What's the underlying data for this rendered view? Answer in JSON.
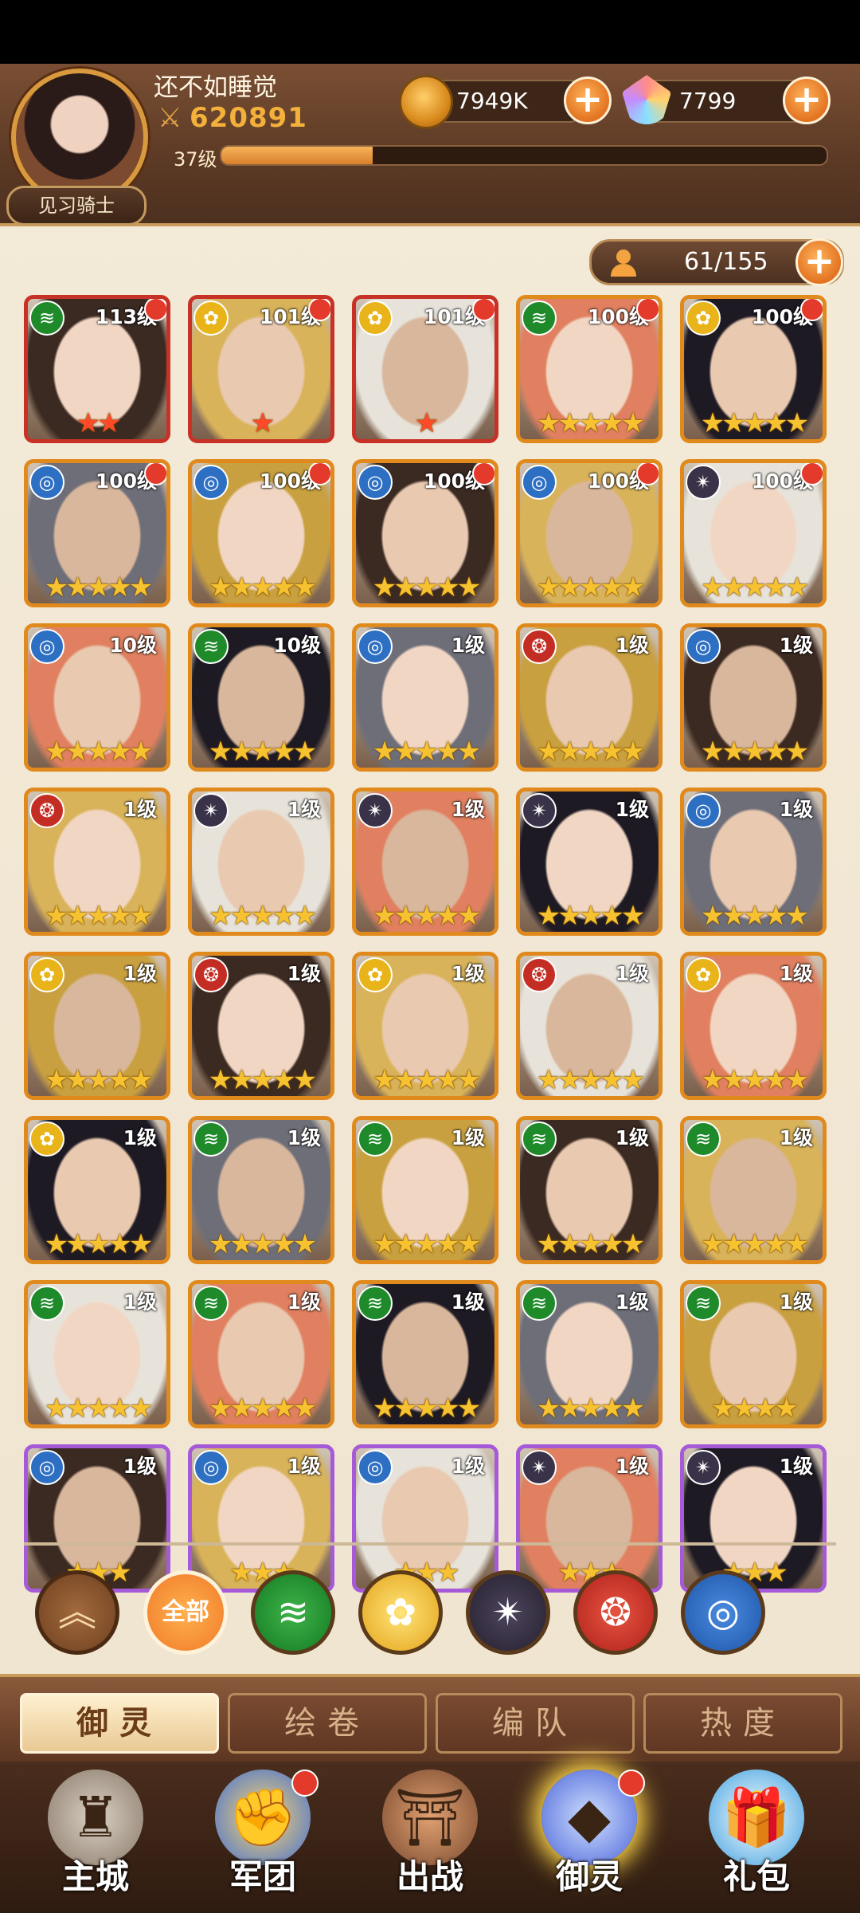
{
  "header": {
    "player_name": "还不如睡觉",
    "power": "620891",
    "level": "37级",
    "exp_progress": 0.25,
    "rank": "见习骑士",
    "gold": "7949K",
    "gems": "7799",
    "roster": "61/155"
  },
  "cards": [
    {
      "level": "113级",
      "element": "wind",
      "stars": 2,
      "frame": "red",
      "dot": true
    },
    {
      "level": "101级",
      "element": "light",
      "stars": 1,
      "frame": "red",
      "dot": true
    },
    {
      "level": "101级",
      "element": "light",
      "stars": 1,
      "frame": "red",
      "dot": true
    },
    {
      "level": "100级",
      "element": "wind",
      "stars": 5,
      "frame": "orange",
      "dot": true
    },
    {
      "level": "100级",
      "element": "light",
      "stars": 5,
      "frame": "orange",
      "dot": true
    },
    {
      "level": "100级",
      "element": "water",
      "stars": 5,
      "frame": "orange",
      "dot": true
    },
    {
      "level": "100级",
      "element": "water",
      "stars": 5,
      "frame": "orange",
      "dot": true
    },
    {
      "level": "100级",
      "element": "water",
      "stars": 5,
      "frame": "orange",
      "dot": true
    },
    {
      "level": "100级",
      "element": "water",
      "stars": 5,
      "frame": "orange",
      "dot": true
    },
    {
      "level": "100级",
      "element": "dark",
      "stars": 5,
      "frame": "orange",
      "dot": true
    },
    {
      "level": "10级",
      "element": "water",
      "stars": 5,
      "frame": "orange",
      "dot": false
    },
    {
      "level": "10级",
      "element": "wind",
      "stars": 5,
      "frame": "orange",
      "dot": false
    },
    {
      "level": "1级",
      "element": "water",
      "stars": 5,
      "frame": "orange",
      "dot": false
    },
    {
      "level": "1级",
      "element": "fire",
      "stars": 5,
      "frame": "orange",
      "dot": false
    },
    {
      "level": "1级",
      "element": "water",
      "stars": 5,
      "frame": "orange",
      "dot": false
    },
    {
      "level": "1级",
      "element": "fire",
      "stars": 5,
      "frame": "orange",
      "dot": false
    },
    {
      "level": "1级",
      "element": "dark",
      "stars": 5,
      "frame": "orange",
      "dot": false
    },
    {
      "level": "1级",
      "element": "dark",
      "stars": 5,
      "frame": "orange",
      "dot": false
    },
    {
      "level": "1级",
      "element": "dark",
      "stars": 5,
      "frame": "orange",
      "dot": false
    },
    {
      "level": "1级",
      "element": "water",
      "stars": 5,
      "frame": "orange",
      "dot": false
    },
    {
      "level": "1级",
      "element": "light",
      "stars": 5,
      "frame": "orange",
      "dot": false
    },
    {
      "level": "1级",
      "element": "fire",
      "stars": 5,
      "frame": "orange",
      "dot": false
    },
    {
      "level": "1级",
      "element": "light",
      "stars": 5,
      "frame": "orange",
      "dot": false
    },
    {
      "level": "1级",
      "element": "fire",
      "stars": 5,
      "frame": "orange",
      "dot": false
    },
    {
      "level": "1级",
      "element": "light",
      "stars": 5,
      "frame": "orange",
      "dot": false
    },
    {
      "level": "1级",
      "element": "light",
      "stars": 5,
      "frame": "orange",
      "dot": false
    },
    {
      "level": "1级",
      "element": "wind",
      "stars": 5,
      "frame": "orange",
      "dot": false
    },
    {
      "level": "1级",
      "element": "wind",
      "stars": 5,
      "frame": "orange",
      "dot": false
    },
    {
      "level": "1级",
      "element": "wind",
      "stars": 5,
      "frame": "orange",
      "dot": false
    },
    {
      "level": "1级",
      "element": "wind",
      "stars": 5,
      "frame": "orange",
      "dot": false
    },
    {
      "level": "1级",
      "element": "wind",
      "stars": 5,
      "frame": "orange",
      "dot": false
    },
    {
      "level": "1级",
      "element": "wind",
      "stars": 5,
      "frame": "orange",
      "dot": false
    },
    {
      "level": "1级",
      "element": "wind",
      "stars": 5,
      "frame": "orange",
      "dot": false
    },
    {
      "level": "1级",
      "element": "wind",
      "stars": 5,
      "frame": "orange",
      "dot": false
    },
    {
      "level": "1级",
      "element": "wind",
      "stars": 4,
      "frame": "orange",
      "dot": false
    },
    {
      "level": "1级",
      "element": "water",
      "stars": 3,
      "frame": "purple",
      "dot": false
    },
    {
      "level": "1级",
      "element": "water",
      "stars": 3,
      "frame": "purple",
      "dot": false
    },
    {
      "level": "1级",
      "element": "water",
      "stars": 3,
      "frame": "purple",
      "dot": false
    },
    {
      "level": "1级",
      "element": "dark",
      "stars": 3,
      "frame": "purple",
      "dot": false
    },
    {
      "level": "1级",
      "element": "dark",
      "stars": 3,
      "frame": "purple",
      "dot": false
    }
  ],
  "filters": {
    "all_label": "全部",
    "icons": [
      "chevron-up-icon",
      "all",
      "wind-element-icon",
      "light-element-icon",
      "dark-element-icon",
      "fire-element-icon",
      "water-element-icon"
    ]
  },
  "sub_tabs": [
    "御灵",
    "绘卷",
    "编队",
    "热度"
  ],
  "nav": [
    {
      "label": "主城",
      "icon": "castle-icon",
      "dot": false
    },
    {
      "label": "军团",
      "icon": "legion-icon",
      "dot": true
    },
    {
      "label": "出战",
      "icon": "battle-icon",
      "dot": false
    },
    {
      "label": "御灵",
      "icon": "crystal-icon",
      "dot": true,
      "active": true
    },
    {
      "label": "礼包",
      "icon": "gift-shop-icon",
      "dot": false
    }
  ],
  "colors": {
    "accent": "#e27321",
    "frame_orange": "#e08a1e",
    "frame_red": "#c83226",
    "frame_purple": "#a65ad8"
  }
}
